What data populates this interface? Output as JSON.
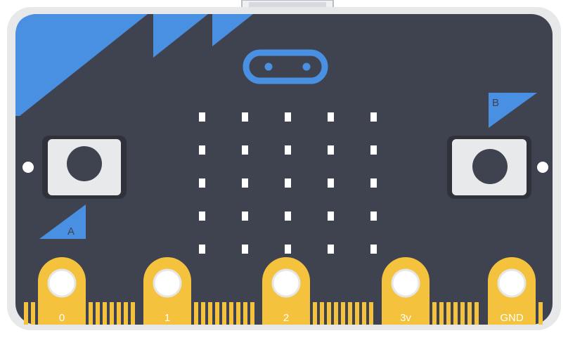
{
  "board": {
    "button_a_label": "A",
    "button_b_label": "B"
  },
  "pins": [
    {
      "label": "0"
    },
    {
      "label": "1"
    },
    {
      "label": "2"
    },
    {
      "label": "3v"
    },
    {
      "label": "GND"
    }
  ],
  "led_matrix": {
    "rows": 5,
    "cols": 5,
    "state": "off"
  },
  "colors": {
    "board": "#3f4350",
    "edge": "#e6e6e6",
    "accent": "#4a90e2",
    "pin_gold": "#f5c23e",
    "led_off": "#ffffff"
  }
}
